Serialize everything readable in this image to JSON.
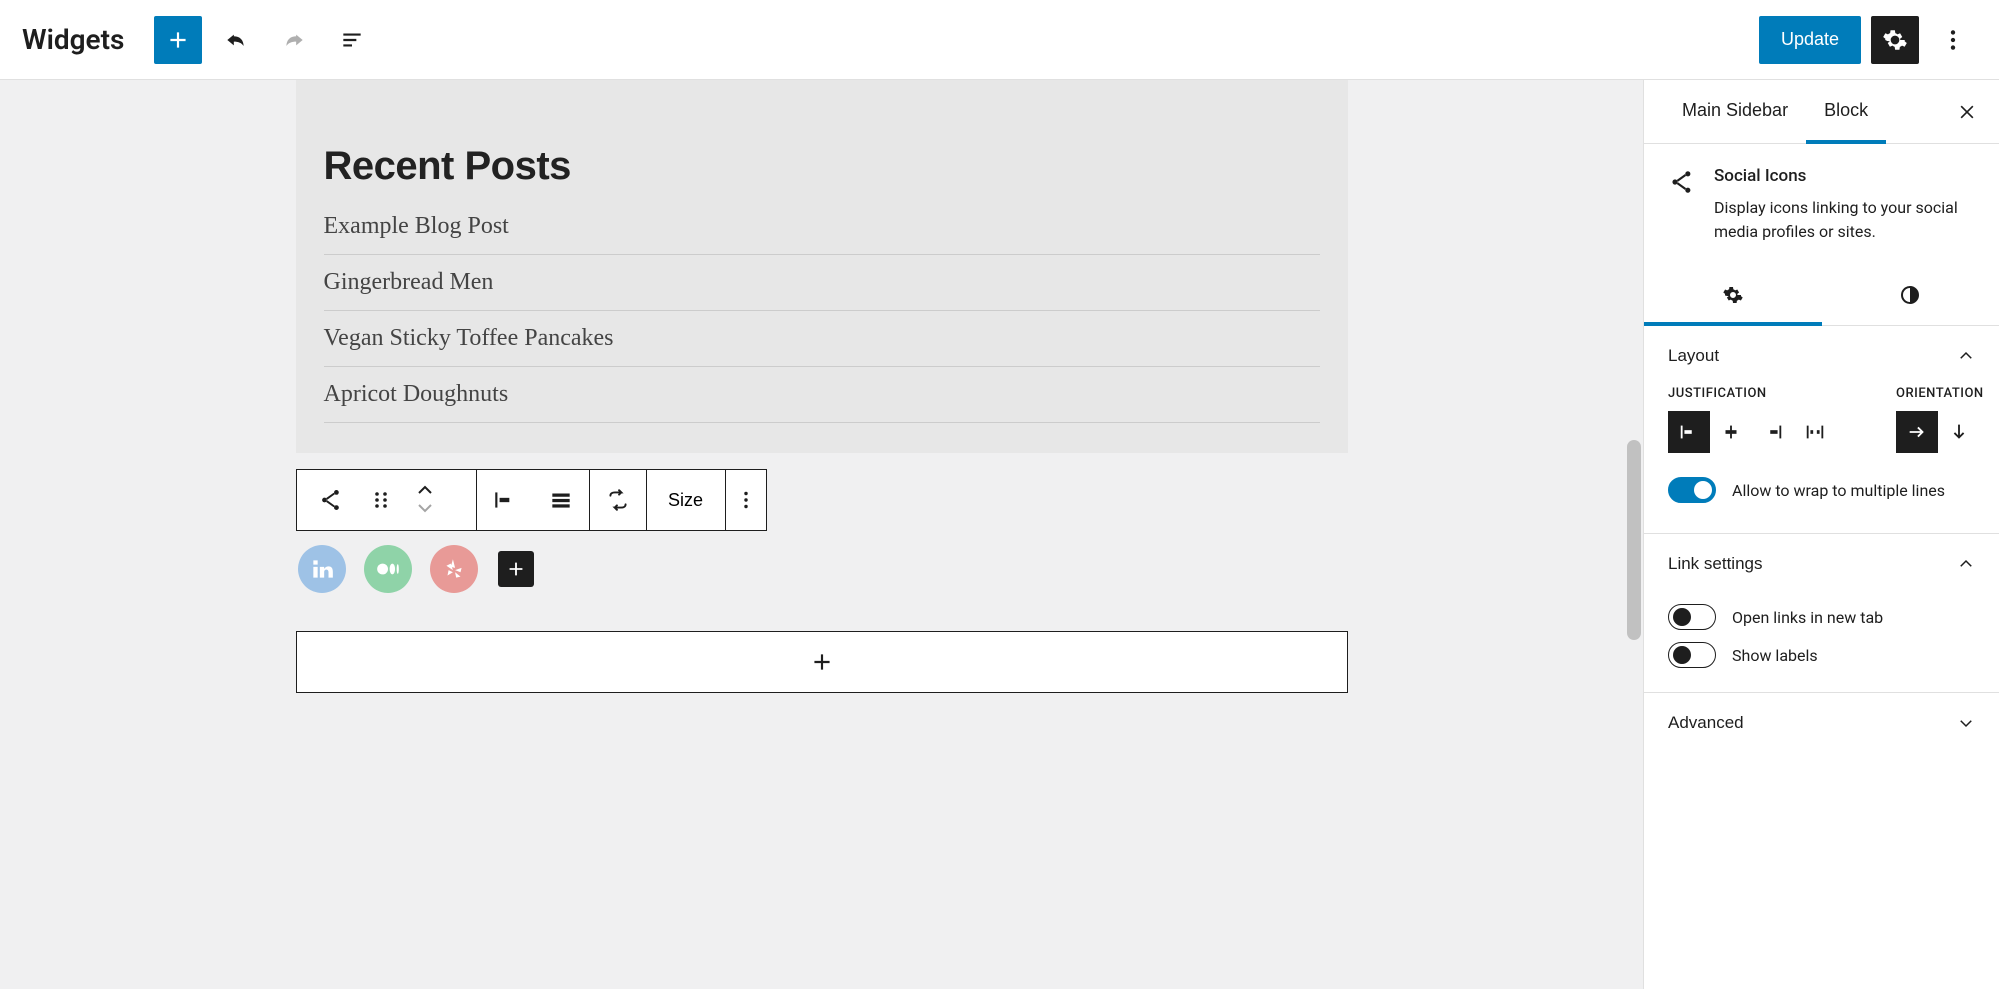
{
  "topbar": {
    "title": "Widgets",
    "update_label": "Update"
  },
  "canvas": {
    "heading": "Recent Posts",
    "posts": [
      "Example Blog Post",
      "Gingerbread Men",
      "Vegan Sticky Toffee Pancakes",
      "Apricot Doughnuts"
    ],
    "toolbar": {
      "size_label": "Size"
    },
    "social_icons": [
      {
        "name": "linkedin",
        "color": "#9ec2e6"
      },
      {
        "name": "medium",
        "color": "#8fd3a8"
      },
      {
        "name": "yelp",
        "color": "#e89a97"
      }
    ]
  },
  "sidebar": {
    "tabs": {
      "main": "Main Sidebar",
      "block": "Block",
      "active": "block"
    },
    "block": {
      "title": "Social Icons",
      "description": "Display icons linking to your social media profiles or sites."
    },
    "panels": {
      "layout": {
        "title": "Layout",
        "justification_label": "JUSTIFICATION",
        "orientation_label": "ORIENTATION",
        "wrap_label": "Allow to wrap to multiple lines",
        "wrap_on": true,
        "justification_active": "left",
        "orientation_active": "horizontal"
      },
      "link": {
        "title": "Link settings",
        "new_tab_label": "Open links in new tab",
        "new_tab_on": false,
        "show_labels_label": "Show labels",
        "show_labels_on": false
      },
      "advanced": {
        "title": "Advanced"
      }
    }
  }
}
